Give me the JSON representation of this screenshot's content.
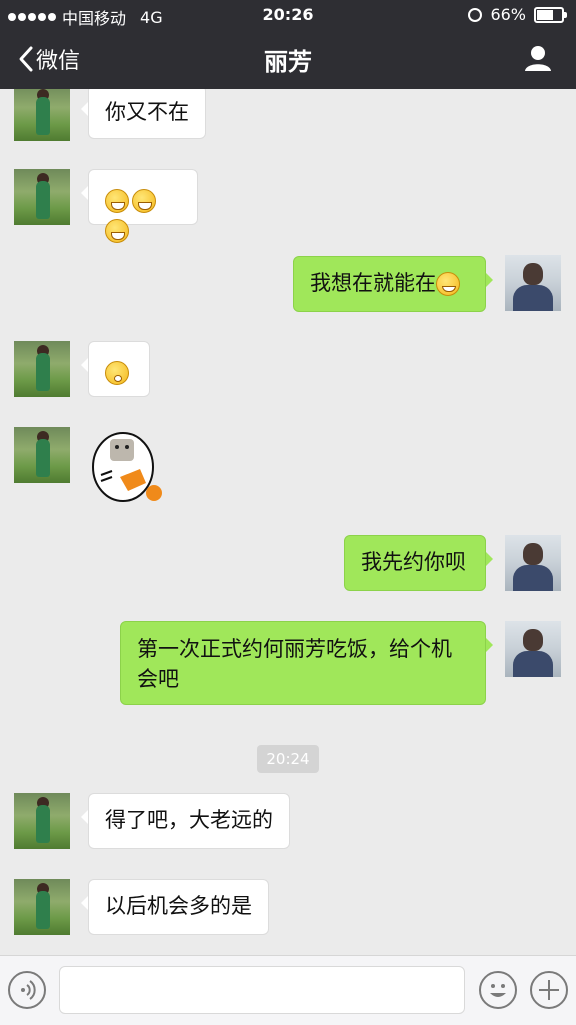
{
  "status_bar": {
    "carrier": "中国移动",
    "network": "4G",
    "time": "20:26",
    "battery": "66%",
    "battery_level": 0.66
  },
  "nav": {
    "back_label": "微信",
    "title": "丽芳"
  },
  "messages": [
    {
      "from": "contact",
      "text": "你又不在"
    },
    {
      "from": "contact",
      "emoji": [
        "grin-icon",
        "grin-icon",
        "grin-icon"
      ]
    },
    {
      "from": "me",
      "text": "我想在就能在",
      "emoji": [
        "heart-eyes-icon"
      ]
    },
    {
      "from": "contact",
      "emoji": [
        "surprised-icon"
      ]
    },
    {
      "from": "contact",
      "sticker": "cartoon-sticker"
    },
    {
      "from": "me",
      "text": "我先约你呗"
    },
    {
      "from": "me",
      "text": "第一次正式约何丽芳吃饭，给个机会吧"
    },
    {
      "timestamp": "20:24"
    },
    {
      "from": "contact",
      "text": "得了吧，大老远的"
    },
    {
      "from": "contact",
      "text": "以后机会多的是"
    }
  ],
  "input_bar": {
    "value": ""
  },
  "colors": {
    "nav_bg": "#2e2e33",
    "chat_bg": "#ebebeb",
    "outgoing_bubble": "#a0e75a",
    "incoming_bubble": "#ffffff"
  }
}
